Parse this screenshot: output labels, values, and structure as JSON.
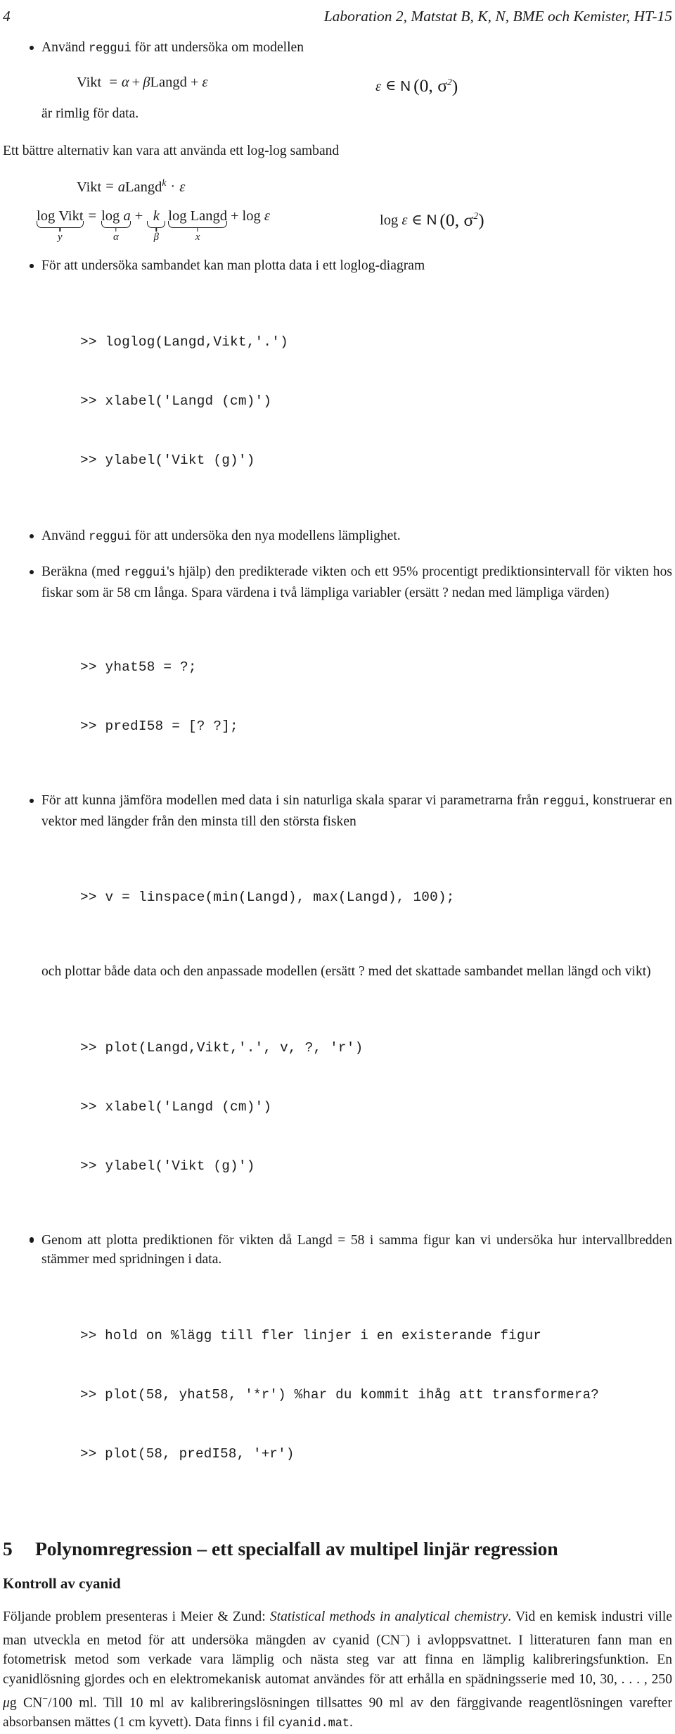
{
  "header": {
    "folio": "4",
    "title": "Laboration 2, Matstat B, K, N, BME och Kemister, HT-15"
  },
  "bullets": {
    "b1_pre": "Använd ",
    "b1_code": "reggui",
    "b1_post": " för att undersöka om modellen",
    "b1_after": "är rimlig för data.",
    "b2": "För att undersöka sambandet kan man plotta data i ett loglog-diagram",
    "b3_pre": "Använd ",
    "b3_code": "reggui",
    "b3_post": " för att undersöka den nya modellens lämplighet.",
    "b4_pre": "Beräkna (med ",
    "b4_code": "reggui",
    "b4_post": "'s hjälp) den predikterade vikten och ett 95% procentigt prediktionsintervall för vikten hos fiskar som är 58 cm långa. Spara värdena i två lämpliga variabler (ersätt ? nedan med lämpliga värden)",
    "b5_pre": "För att kunna jämföra modellen med data i sin naturliga skala sparar vi parametrarna från ",
    "b5_code": "reggui",
    "b5_post": ", konstruerar en vektor med längder från den minsta till den största fisken",
    "b6": "Genom att plotta prediktionen för vikten då Langd = 58 i samma figur kan vi undersöka hur intervallbredden stämmer med spridningen i data."
  },
  "paragraphs": {
    "p_loglog": "Ett bättre alternativ kan vara att använda ett log-log samband",
    "p_plot": "och plottar både data och den anpassade modellen (ersätt ? med det skattade sambandet mellan längd och vikt)"
  },
  "equations": {
    "eq1": {
      "lhs_vikt": "Vikt",
      "equals": "=",
      "alpha": "α",
      "plus": "+",
      "beta": "β",
      "langd": "Langd",
      "plus2": "+",
      "epsilon": "ε",
      "rhs_eps": "ε",
      "in": "∈",
      "N": "N",
      "dist": "(0, σ",
      "sup2": "2",
      "close": ")"
    },
    "eq2": {
      "vikt": "Vikt",
      "equals": "=",
      "a": "a",
      "langd": "Langd",
      "k": "k",
      "dot": "·",
      "epsilon": "ε"
    },
    "eq3": {
      "log": "log",
      "vikt": "Vikt",
      "equals": "=",
      "loga": "log",
      "a": "a",
      "plus": "+",
      "k": "k",
      "loglangd": "log",
      "langd": "Langd",
      "plus2": "+",
      "logeps": "log",
      "epsilon": "ε",
      "under_y": "y",
      "under_alpha": "α",
      "under_beta": "β",
      "under_x": "x",
      "rhs_log": "log",
      "rhs_eps": "ε",
      "in": "∈",
      "N": "N",
      "dist": "(0, σ",
      "sup2": "2",
      "close": ")"
    }
  },
  "code_blocks": {
    "block1": [
      ">> loglog(Langd,Vikt,'.')",
      ">> xlabel('Langd (cm)')",
      ">> ylabel('Vikt (g)')"
    ],
    "block2": [
      ">> yhat58 = ?;",
      ">> predI58 = [? ?];"
    ],
    "block3": [
      ">> v = linspace(min(Langd), max(Langd), 100);"
    ],
    "block4": [
      ">> plot(Langd,Vikt,'.', v, ?, 'r')",
      ">> xlabel('Langd (cm)')",
      ">> ylabel('Vikt (g)')"
    ],
    "block5": [
      ">> hold on %lägg till fler linjer i en existerande figur",
      ">> plot(58, yhat58, '*r') %har du kommit ihåg att transformera?",
      ">> plot(58, predI58, '+r')"
    ]
  },
  "section": {
    "number": "5",
    "title": "Polynomregression – ett specialfall av multipel linjär regression",
    "subtitle": "Kontroll av cyanid"
  },
  "final_paragraph": {
    "part1": "Följande problem presenteras i Meier & Zund: ",
    "italic_title": "Statistical methods in analytical chemistry",
    "part2": ". Vid en kemisk industri ville man utveckla en metod för att undersöka mängden av cyanid (CN",
    "sup_minus": "−",
    "part3": ") i avloppsvattnet. I litteraturen fann man en fotometrisk metod som verkade vara lämplig och nästa steg var att finna en lämplig kalibreringsfunktion. En cyanidlösning gjordes och en elektromekanisk automat användes för att erhålla en spädningsserie med 10, 30, . . . , 250 ",
    "mu": "μ",
    "part4": "g CN",
    "sup_minus2": "−",
    "part5": "/100 ml. Till 10 ml av kalibreringslösningen tillsattes 90 ml av den färggivande reagentlösningen varefter absorbansen mättes (1 cm kyvett). Data finns i fil ",
    "file_code": "cyanid.mat",
    "part6": "."
  }
}
